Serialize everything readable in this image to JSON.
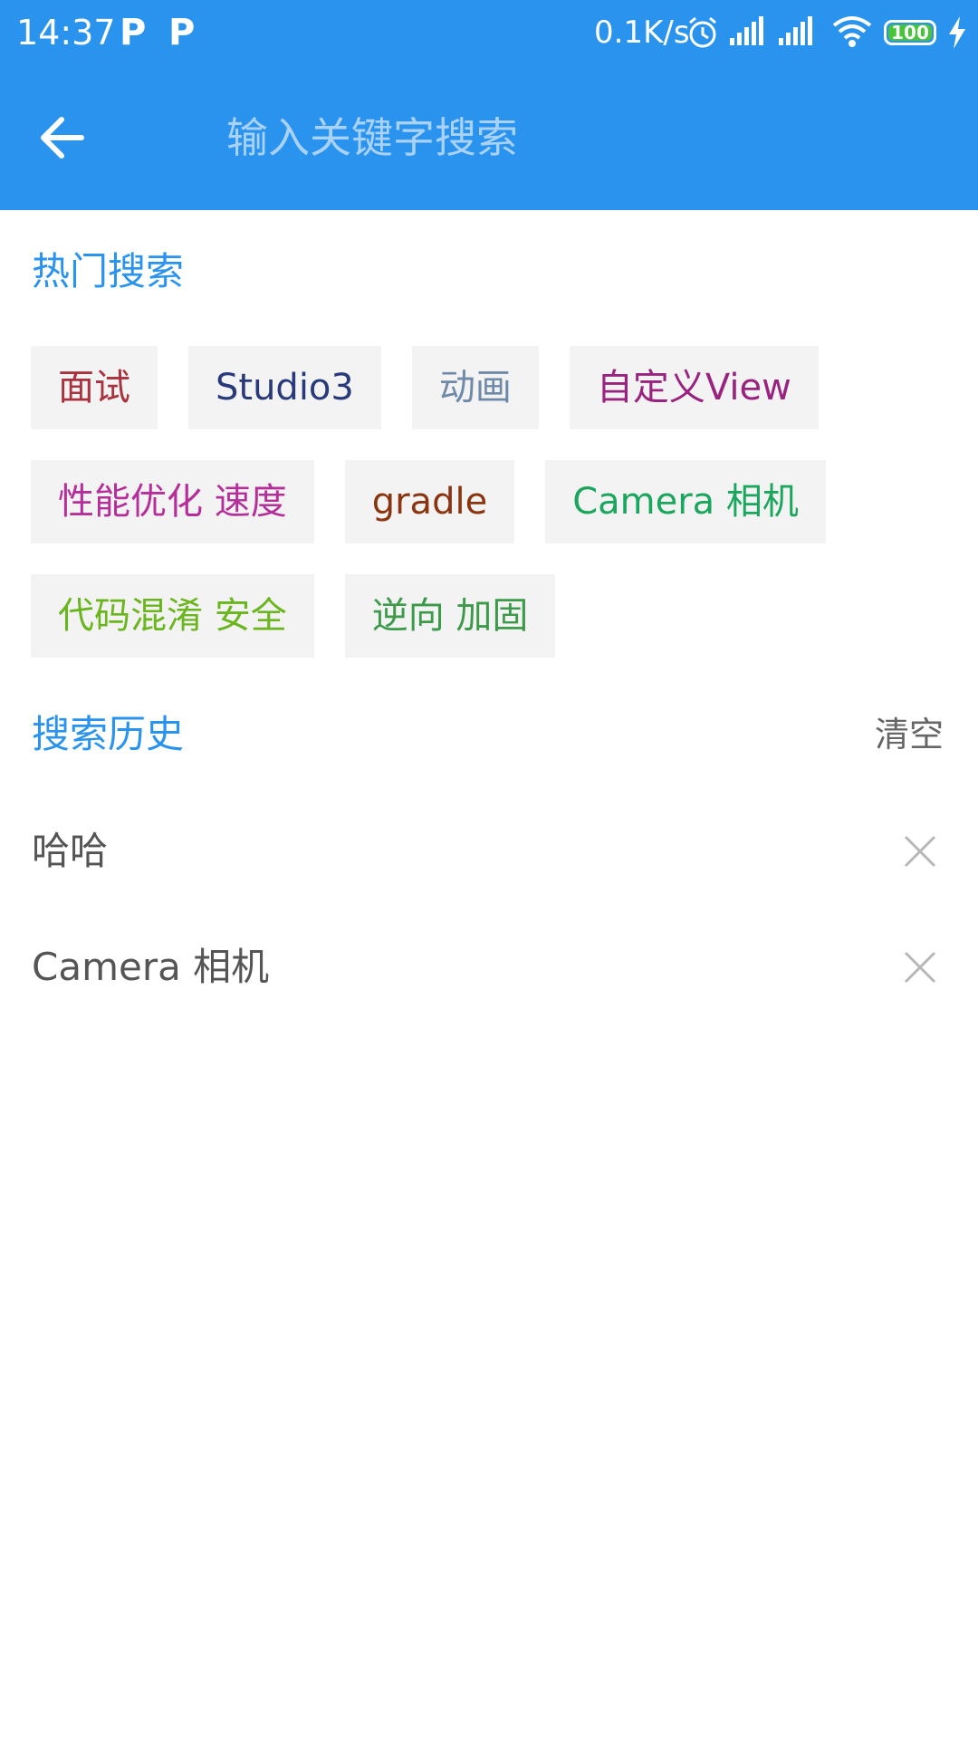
{
  "status_bar": {
    "time": "14:37",
    "notification_icons": [
      "P",
      "P"
    ],
    "net_speed": "0.1K/s",
    "battery": "100",
    "battery_level": 1.0,
    "icons": [
      "alarm-icon",
      "signal-icon",
      "signal-icon",
      "wifi-icon",
      "battery-icon",
      "charging-icon"
    ]
  },
  "toolbar": {
    "back_icon": "back-arrow-icon",
    "search_placeholder": "输入关键字搜索",
    "search_value": ""
  },
  "hot_search": {
    "title": "热门搜索",
    "rows": [
      [
        {
          "label": "面试",
          "color": "#a8323d"
        },
        {
          "label": "Studio3",
          "color": "#283a7a"
        },
        {
          "label": "动画",
          "color": "#6f8aa8"
        },
        {
          "label": "自定义View",
          "color": "#9a2380"
        }
      ],
      [
        {
          "label": "性能优化 速度",
          "color": "#b52f9a"
        },
        {
          "label": "gradle",
          "color": "#8b3410"
        },
        {
          "label": "Camera 相机",
          "color": "#1aa65d"
        }
      ],
      [
        {
          "label": "代码混淆 安全",
          "color": "#6bb51f"
        },
        {
          "label": "逆向 加固",
          "color": "#3d9a4a"
        }
      ]
    ]
  },
  "history": {
    "title": "搜索历史",
    "clear_label": "清空",
    "items": [
      {
        "text": "哈哈"
      },
      {
        "text": "Camera 相机"
      }
    ]
  },
  "colors": {
    "primary": "#2a93ee",
    "tag_background": "#f3f3f3"
  }
}
